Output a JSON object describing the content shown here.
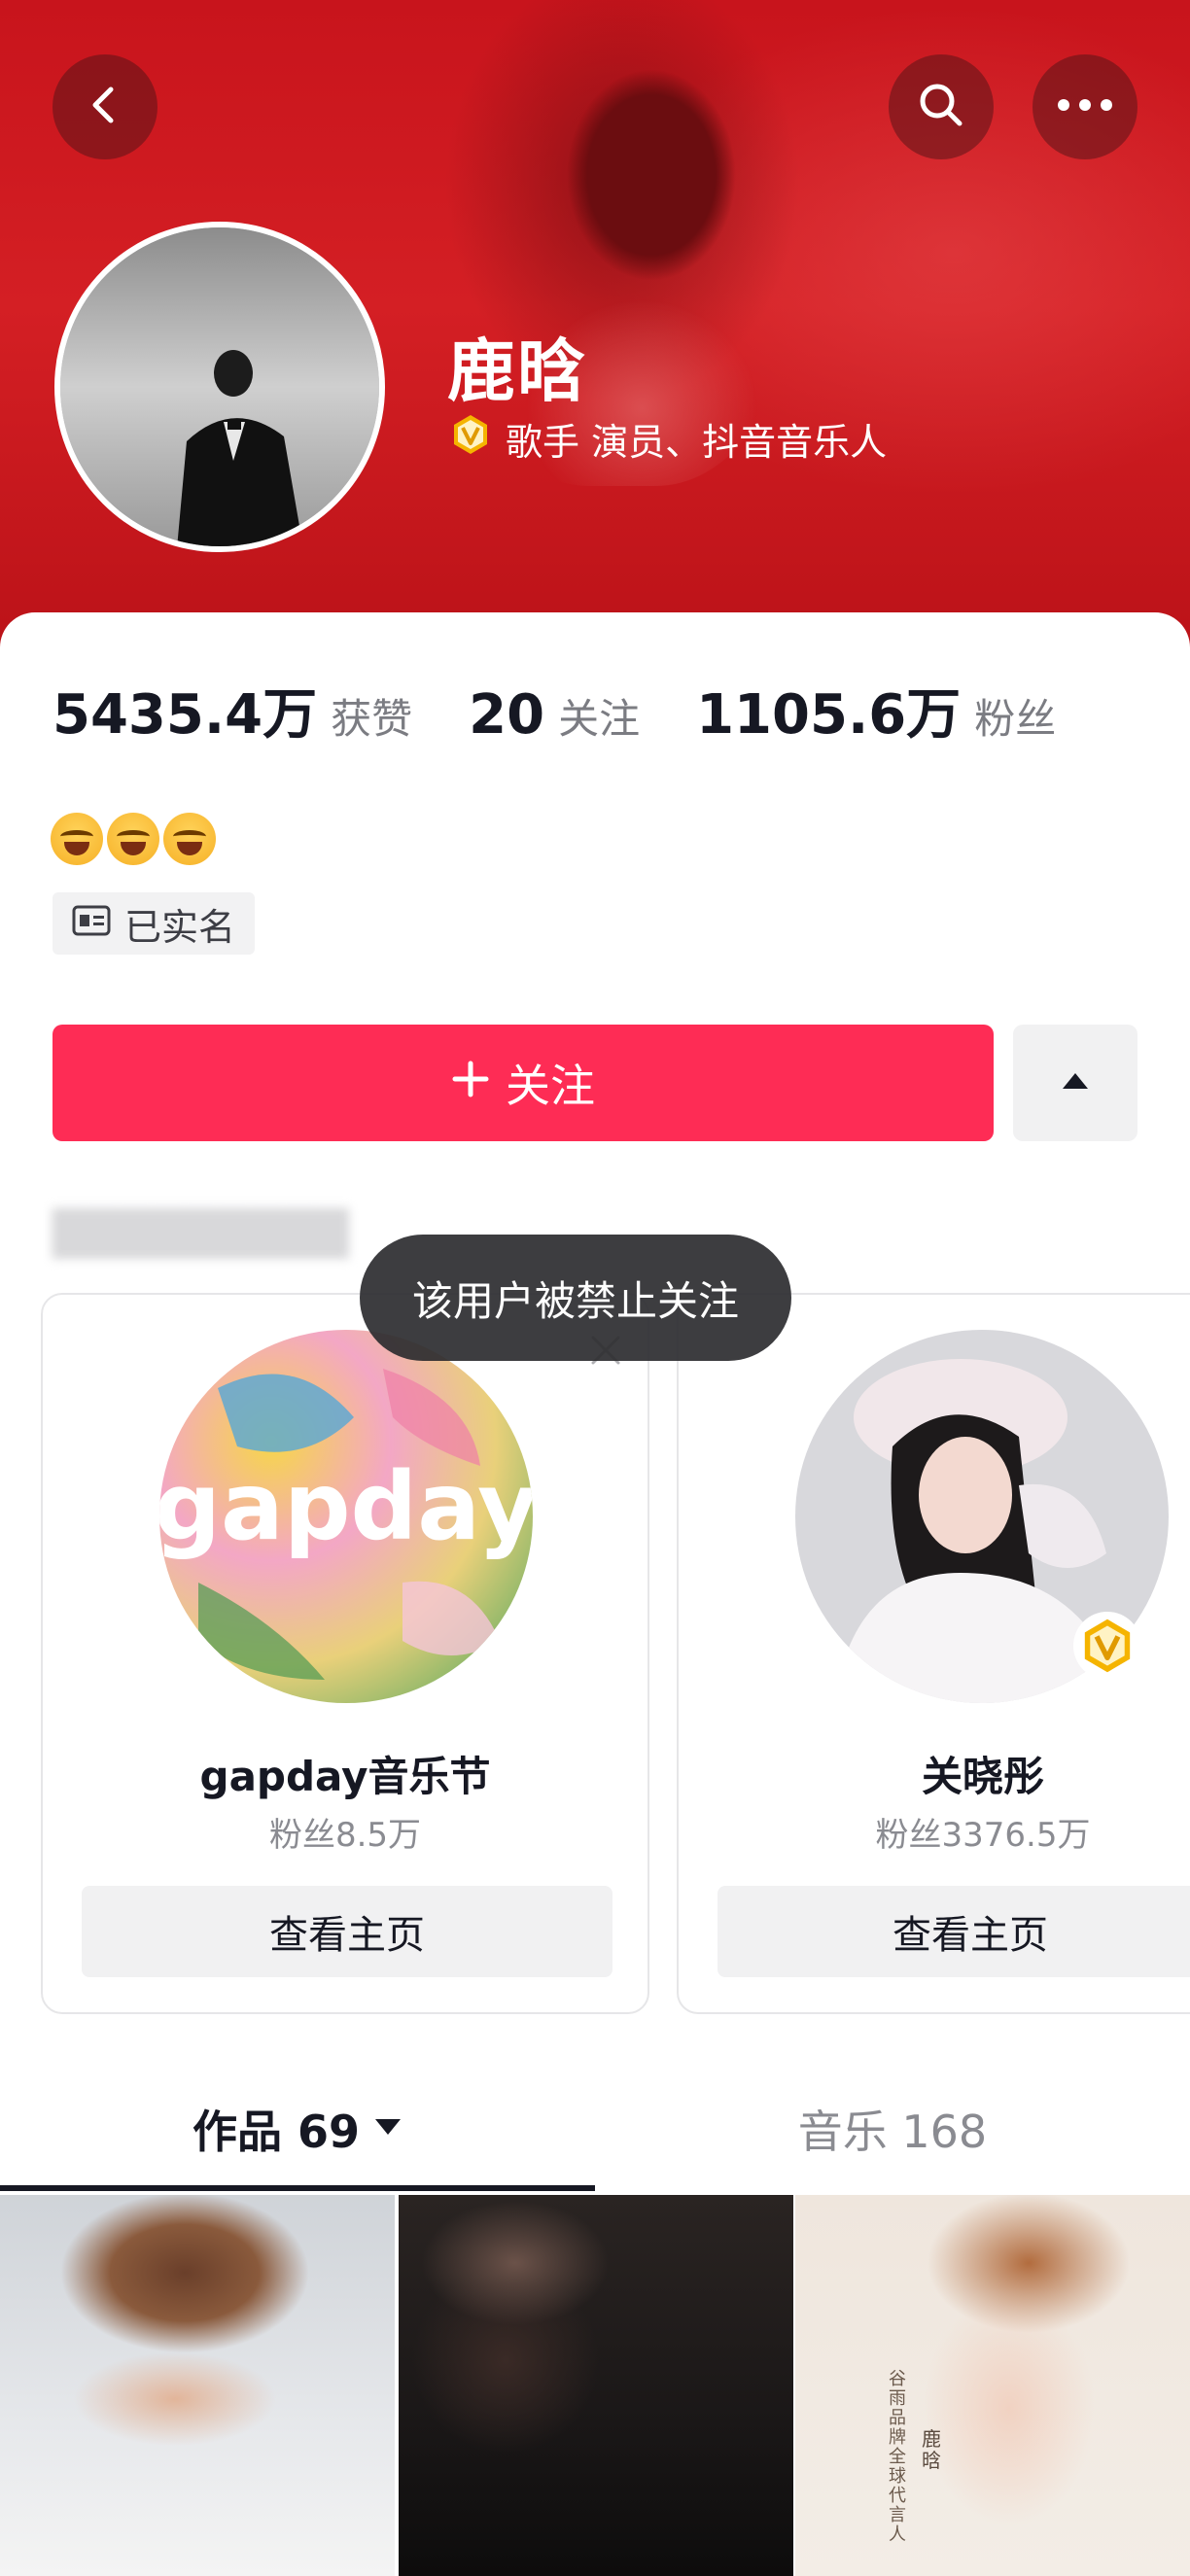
{
  "profile": {
    "name": "鹿晗",
    "verify_text": "歌手 演员、抖音音乐人"
  },
  "stats": [
    {
      "value": "5435.4万",
      "label": "获赞"
    },
    {
      "value": "20",
      "label": "关注"
    },
    {
      "value": "1105.6万",
      "label": "粉丝"
    }
  ],
  "bio": {
    "emojis": [
      "laugh-cry-emoji",
      "laugh-cry-emoji",
      "laugh-cry-emoji"
    ],
    "realname_label": "已实名"
  },
  "actions": {
    "follow_label": "关注"
  },
  "toast": {
    "text": "该用户被禁止关注"
  },
  "recommendations": [
    {
      "name": "gapday音乐节",
      "fans": "粉丝8.5万",
      "button": "查看主页",
      "logo_text": "gapday"
    },
    {
      "name": "关晓彤",
      "fans": "粉丝3376.5万",
      "button": "查看主页"
    }
  ],
  "tabs": [
    {
      "label": "作品 69",
      "active": true
    },
    {
      "label": "音乐 168",
      "active": false
    }
  ],
  "thumbnails": [
    {
      "id": "thumb-1"
    },
    {
      "id": "thumb-2"
    },
    {
      "id": "thumb-3",
      "caption": "谷雨品牌全球代言人",
      "caption_name": "鹿晗"
    }
  ],
  "colors": {
    "banner_red": "#d41f24",
    "follow_button": "#fe2c55",
    "verify_gold": "#f5b400",
    "toast_bg": "#2c2c30"
  }
}
